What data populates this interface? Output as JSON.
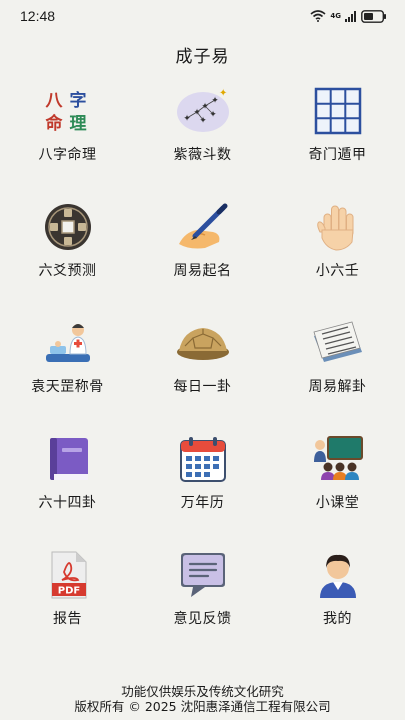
{
  "status_bar": {
    "time": "12:48",
    "network_label": "4G",
    "icons": [
      "wifi-icon",
      "signal-icon",
      "battery-icon"
    ]
  },
  "header": {
    "title": "成子易"
  },
  "grid": {
    "items": [
      {
        "label": "八字命理",
        "icon": "bazi-characters-icon"
      },
      {
        "label": "紫薇斗数",
        "icon": "star-chart-icon"
      },
      {
        "label": "奇门遁甲",
        "icon": "nine-grid-icon"
      },
      {
        "label": "六爻预测",
        "icon": "ancient-coin-icon"
      },
      {
        "label": "周易起名",
        "icon": "writing-hand-icon"
      },
      {
        "label": "小六壬",
        "icon": "raised-hand-icon"
      },
      {
        "label": "袁天罡称骨",
        "icon": "doctor-scale-icon"
      },
      {
        "label": "每日一卦",
        "icon": "tortoise-shell-icon"
      },
      {
        "label": "周易解卦",
        "icon": "newspaper-icon"
      },
      {
        "label": "六十四卦",
        "icon": "book-icon"
      },
      {
        "label": "万年历",
        "icon": "calendar-icon"
      },
      {
        "label": "小课堂",
        "icon": "classroom-icon"
      },
      {
        "label": "报告",
        "icon": "pdf-file-icon"
      },
      {
        "label": "意见反馈",
        "icon": "feedback-message-icon"
      },
      {
        "label": "我的",
        "icon": "user-profile-icon"
      }
    ]
  },
  "icon_text": {
    "bazi_chars": [
      "八",
      "字",
      "命",
      "理"
    ],
    "pdf": "PDF"
  },
  "colors": {
    "background": "#f2f2ee",
    "bazi_red": "#c0392b",
    "bazi_green": "#2e8b57",
    "bazi_blue": "#2c4f9e",
    "book_purple": "#7b5bc4",
    "calendar_red": "#e74c3c",
    "pdf_red": "#d63a2f"
  },
  "footer": {
    "disclaimer": "功能仅供娱乐及传统文化研究",
    "copyright": "版权所有 © 2025 沈阳惠泽通信工程有限公司"
  }
}
